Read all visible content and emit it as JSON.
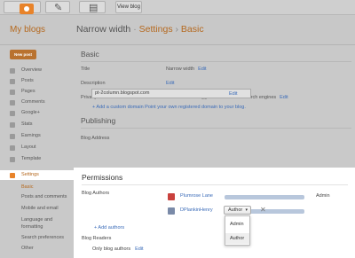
{
  "topbar": {
    "view_blog_label": "View blog",
    "icons": [
      "blogger-logo-icon",
      "pencil-icon",
      "documents-icon"
    ]
  },
  "header": {
    "my_blogs": "My blogs",
    "breadcrumb": {
      "blog": "Narrow width",
      "sep1": " · ",
      "section": "Settings",
      "sep2": " › ",
      "page": "Basic"
    }
  },
  "nav": {
    "new_post": "New post",
    "items": [
      {
        "label": "Overview",
        "icon": "overview-icon"
      },
      {
        "label": "Posts",
        "icon": "posts-icon"
      },
      {
        "label": "Pages",
        "icon": "pages-icon"
      },
      {
        "label": "Comments",
        "icon": "comments-icon"
      },
      {
        "label": "Google+",
        "icon": "google-plus-icon"
      },
      {
        "label": "Stats",
        "icon": "stats-icon"
      },
      {
        "label": "Earnings",
        "icon": "earnings-icon"
      },
      {
        "label": "Layout",
        "icon": "layout-icon"
      },
      {
        "label": "Template",
        "icon": "template-icon"
      },
      {
        "label": "Settings",
        "icon": "wrench-icon"
      }
    ],
    "sub_items": [
      "Basic",
      "Posts and comments",
      "Mobile and email",
      "Language and",
      "formatting",
      "Search preferences",
      "Other"
    ]
  },
  "basic": {
    "heading": "Basic",
    "rows": [
      {
        "label": "Title",
        "value": "Narrow width",
        "action": "Edit"
      },
      {
        "label": "Description",
        "value": "",
        "action": "Edit"
      },
      {
        "label": "Privacy",
        "value": "Not listed on Blogger. Not visible to search engines",
        "action": "Edit"
      }
    ]
  },
  "publishing": {
    "heading": "Publishing",
    "label": "Blog Address",
    "address": "pt-2column.blogspot.com",
    "action": "Edit",
    "custom_domain": "+ Add a custom domain Point your own registered domain to your blog."
  },
  "permissions": {
    "heading": "Permissions",
    "authors_label": "Blog Authors",
    "authors": [
      {
        "name": "Plumrose Lane",
        "role": "Admin"
      },
      {
        "name": "DPlankinHenry",
        "role": "Author"
      }
    ],
    "add_authors": "+ Add authors",
    "readers_label": "Blog Readers",
    "readers_value": "Only blog authors",
    "readers_action": "Edit",
    "role_options": [
      "Admin",
      "Author"
    ],
    "selected_role": "Author"
  },
  "colors": {
    "accent": "#e8832a",
    "link": "#3a6bb8",
    "dim_bg": "#c9c9c9"
  }
}
